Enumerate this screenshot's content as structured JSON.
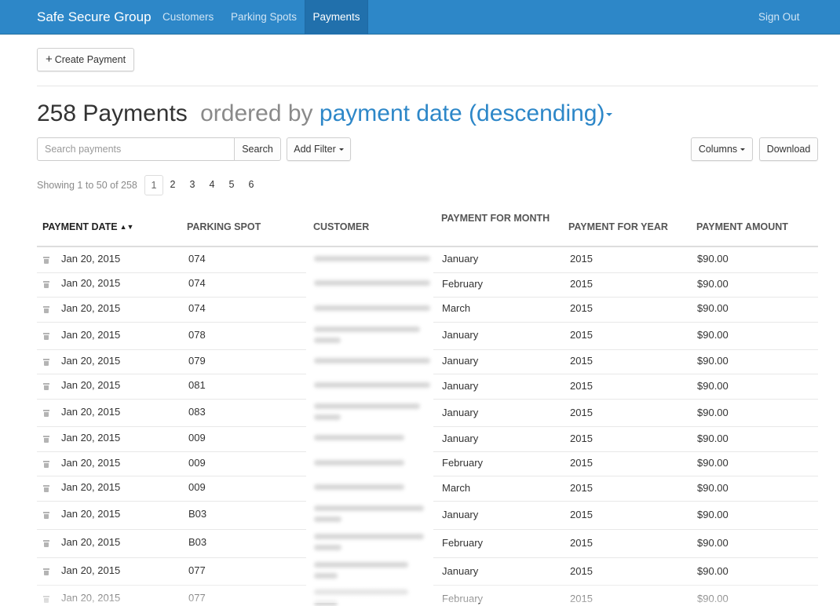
{
  "navbar": {
    "brand": "Safe Secure Group",
    "links": [
      "Customers",
      "Parking Spots",
      "Payments"
    ],
    "active": "Payments",
    "sign_out": "Sign Out"
  },
  "toolbar": {
    "create_label": "Create Payment"
  },
  "heading": {
    "count": "258 Payments",
    "ordered_by": "ordered by",
    "sort_field": "payment date (descending)"
  },
  "search": {
    "placeholder": "Search payments",
    "button": "Search",
    "add_filter": "Add Filter",
    "columns": "Columns",
    "download": "Download"
  },
  "pagination": {
    "showing": "Showing 1 to 50 of 258",
    "pages": [
      "1",
      "2",
      "3",
      "4",
      "5",
      "6"
    ],
    "current": "1"
  },
  "table": {
    "headers": [
      "PAYMENT DATE",
      "PARKING SPOT",
      "CUSTOMER",
      "PAYMENT FOR MONTH",
      "PAYMENT FOR YEAR",
      "PAYMENT AMOUNT"
    ],
    "sorted_column": "PAYMENT DATE",
    "rows": [
      {
        "date": "Jan 20, 2015",
        "spot": "074",
        "month": "January",
        "year": "2015",
        "amount": "$90.00"
      },
      {
        "date": "Jan 20, 2015",
        "spot": "074",
        "month": "February",
        "year": "2015",
        "amount": "$90.00"
      },
      {
        "date": "Jan 20, 2015",
        "spot": "074",
        "month": "March",
        "year": "2015",
        "amount": "$90.00"
      },
      {
        "date": "Jan 20, 2015",
        "spot": "078",
        "month": "January",
        "year": "2015",
        "amount": "$90.00"
      },
      {
        "date": "Jan 20, 2015",
        "spot": "079",
        "month": "January",
        "year": "2015",
        "amount": "$90.00"
      },
      {
        "date": "Jan 20, 2015",
        "spot": "081",
        "month": "January",
        "year": "2015",
        "amount": "$90.00"
      },
      {
        "date": "Jan 20, 2015",
        "spot": "083",
        "month": "January",
        "year": "2015",
        "amount": "$90.00"
      },
      {
        "date": "Jan 20, 2015",
        "spot": "009",
        "month": "January",
        "year": "2015",
        "amount": "$90.00"
      },
      {
        "date": "Jan 20, 2015",
        "spot": "009",
        "month": "February",
        "year": "2015",
        "amount": "$90.00"
      },
      {
        "date": "Jan 20, 2015",
        "spot": "009",
        "month": "March",
        "year": "2015",
        "amount": "$90.00"
      },
      {
        "date": "Jan 20, 2015",
        "spot": "B03",
        "month": "January",
        "year": "2015",
        "amount": "$90.00"
      },
      {
        "date": "Jan 20, 2015",
        "spot": "B03",
        "month": "February",
        "year": "2015",
        "amount": "$90.00"
      },
      {
        "date": "Jan 20, 2015",
        "spot": "077",
        "month": "January",
        "year": "2015",
        "amount": "$90.00"
      },
      {
        "date": "Jan 20, 2015",
        "spot": "077",
        "month": "February",
        "year": "2015",
        "amount": "$90.00"
      }
    ]
  },
  "colors": {
    "navbar": "#2d87c8",
    "navbar_active": "#2170ac",
    "accent": "#2d87c8"
  },
  "icons": {
    "row_delete": "trash-icon",
    "sort": "sort-icon",
    "create": "plus-icon"
  }
}
